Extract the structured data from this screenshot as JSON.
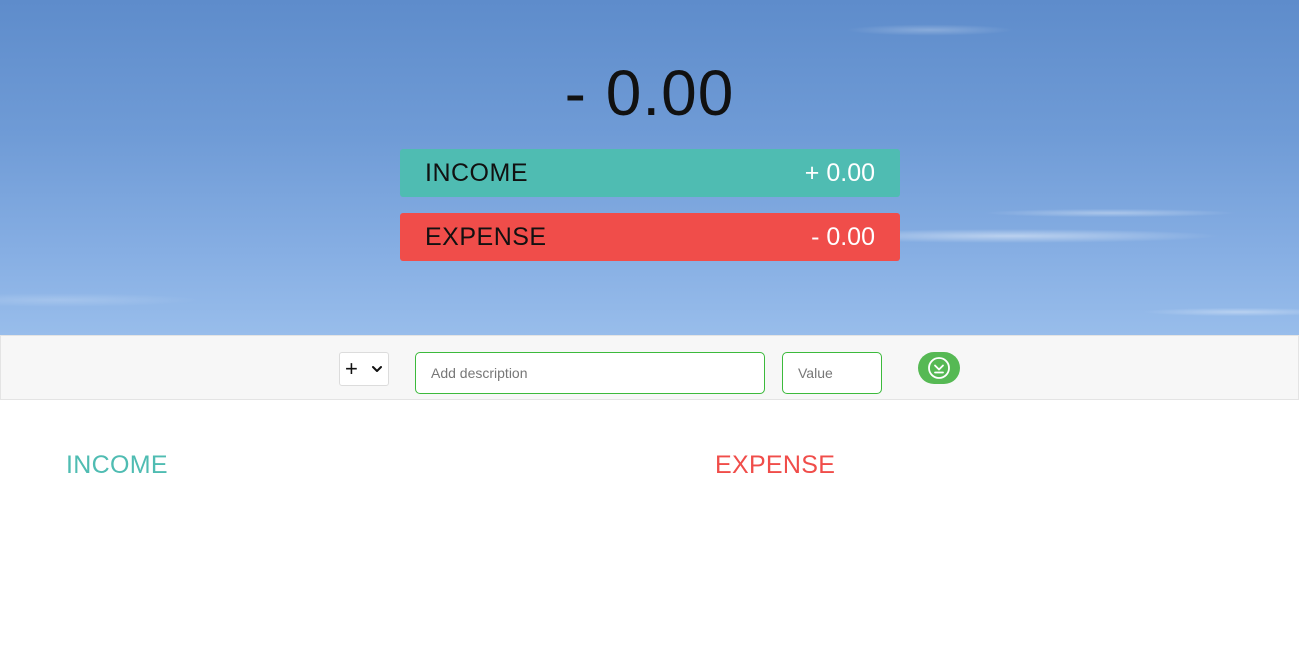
{
  "budget": {
    "value": "- 0.00"
  },
  "summary": {
    "income": {
      "label": "INCOME",
      "value": "+ 0.00",
      "color": "#4fbcb2"
    },
    "expense": {
      "label": "EXPENSE",
      "value": "- 0.00",
      "color": "#f04d4a"
    }
  },
  "add_form": {
    "type_selected": "+",
    "type_chevron_icon": "chevron-down-icon",
    "description_placeholder": "Add description",
    "value_placeholder": "Value",
    "submit_icon": "circle-arrow-down-icon",
    "accent_color": "#3cba3c"
  },
  "lists": {
    "income_title": "INCOME",
    "expense_title": "EXPENSE"
  }
}
